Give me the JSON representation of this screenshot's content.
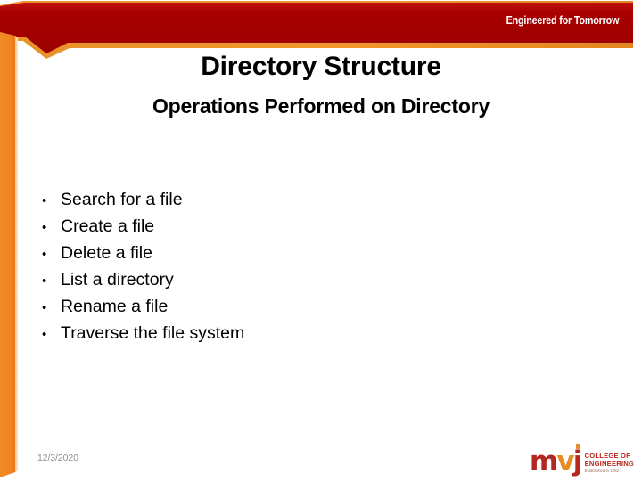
{
  "slide": {
    "title": "Directory Structure",
    "subtitle": "Operations Performed on Directory",
    "bullet_marker": "•",
    "bullets": [
      "Search for a file",
      "Create a file",
      "Delete a file",
      "List a directory",
      "Rename a file",
      "Traverse the file system"
    ]
  },
  "banner": {
    "tagline": "Engineered for Tomorrow",
    "red": "#A80000",
    "red_light": "#C21111",
    "orange": "#E8922A"
  },
  "sidebar": {
    "orange": "#F08522",
    "orange_dark": "#E0761A"
  },
  "footer": {
    "date": "12/3/2020",
    "date_color": "#8e8e8e"
  },
  "logo": {
    "mark_m": "m",
    "mark_v": "v",
    "mark_j": "j",
    "line1": "COLLEGE OF",
    "line2": "ENGINEERING",
    "line3": "Established in 1982",
    "maroon": "#B5261E",
    "orange": "#E88B22"
  }
}
